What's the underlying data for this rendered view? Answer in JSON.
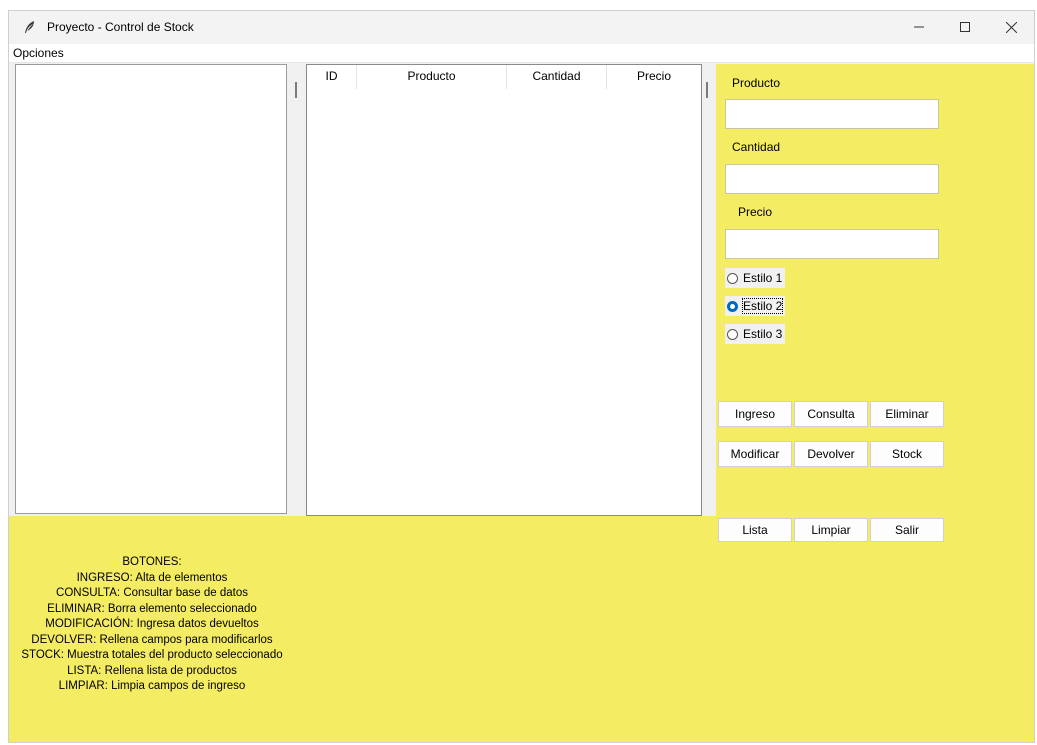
{
  "window": {
    "title": "Proyecto - Control de Stock",
    "controls": {
      "minimize": "—",
      "maximize": "☐",
      "close": "✕"
    }
  },
  "menu": {
    "options": "Opciones"
  },
  "table": {
    "columns": [
      "ID",
      "Producto",
      "Cantidad",
      "Precio"
    ],
    "rows": []
  },
  "form": {
    "producto_label": "Producto",
    "cantidad_label": "Cantidad",
    "precio_label": "Precio",
    "producto_value": "",
    "cantidad_value": "",
    "precio_value": "",
    "styles": [
      {
        "label": "Estilo 1",
        "selected": false
      },
      {
        "label": "Estilo 2",
        "selected": true
      },
      {
        "label": "Estilo 3",
        "selected": false
      }
    ]
  },
  "buttons": {
    "ingreso": "Ingreso",
    "consulta": "Consulta",
    "eliminar": "Eliminar",
    "modificar": "Modificar",
    "devolver": "Devolver",
    "stock": "Stock",
    "lista": "Lista",
    "limpiar": "Limpiar",
    "salir": "Salir"
  },
  "help": {
    "lines": [
      "BOTONES:",
      "INGRESO: Alta de elementos",
      "CONSULTA: Consultar base de datos",
      "ELIMINAR: Borra elemento seleccionado",
      "MODIFICACIÓN: Ingresa datos devueltos",
      "DEVOLVER: Rellena campos para modificarlos",
      "STOCK: Muestra totales del producto seleccionado",
      "LISTA: Rellena lista de productos",
      "LIMPIAR: Limpia campos de ingreso"
    ]
  },
  "colors": {
    "panel_yellow": "#f4ec62",
    "radio_accent": "#0067c0"
  }
}
